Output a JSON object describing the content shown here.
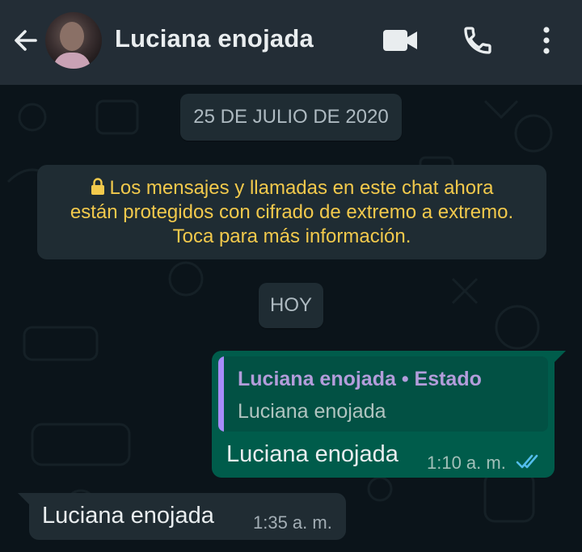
{
  "header": {
    "contact_name": "Luciana enojada",
    "back_icon": "arrow-left-icon",
    "video_icon": "video-camera-icon",
    "call_icon": "phone-icon",
    "menu_icon": "more-vertical-icon",
    "background_color": "#232d36"
  },
  "chat": {
    "date_separator": "25 DE JULIO DE 2020",
    "encryption_notice": {
      "line1": "Los mensajes y llamadas en este chat ahora",
      "line2": "están protegidos con cifrado de extremo a extremo.",
      "line3": "Toca para más información.",
      "icon": "lock-icon",
      "color": "#f2c94c"
    },
    "today_separator": "HOY",
    "messages": [
      {
        "direction": "outgoing",
        "quoted": {
          "author": "Luciana enojada • Estado",
          "text": "Luciana enojada"
        },
        "text": "Luciana enojada",
        "time": "1:10 a. m.",
        "status_icon": "double-check-read-icon",
        "bubble_color": "#005c4b"
      },
      {
        "direction": "incoming",
        "text": "Luciana enojada",
        "time": "1:35 a. m.",
        "bubble_color": "#202c33"
      }
    ]
  }
}
